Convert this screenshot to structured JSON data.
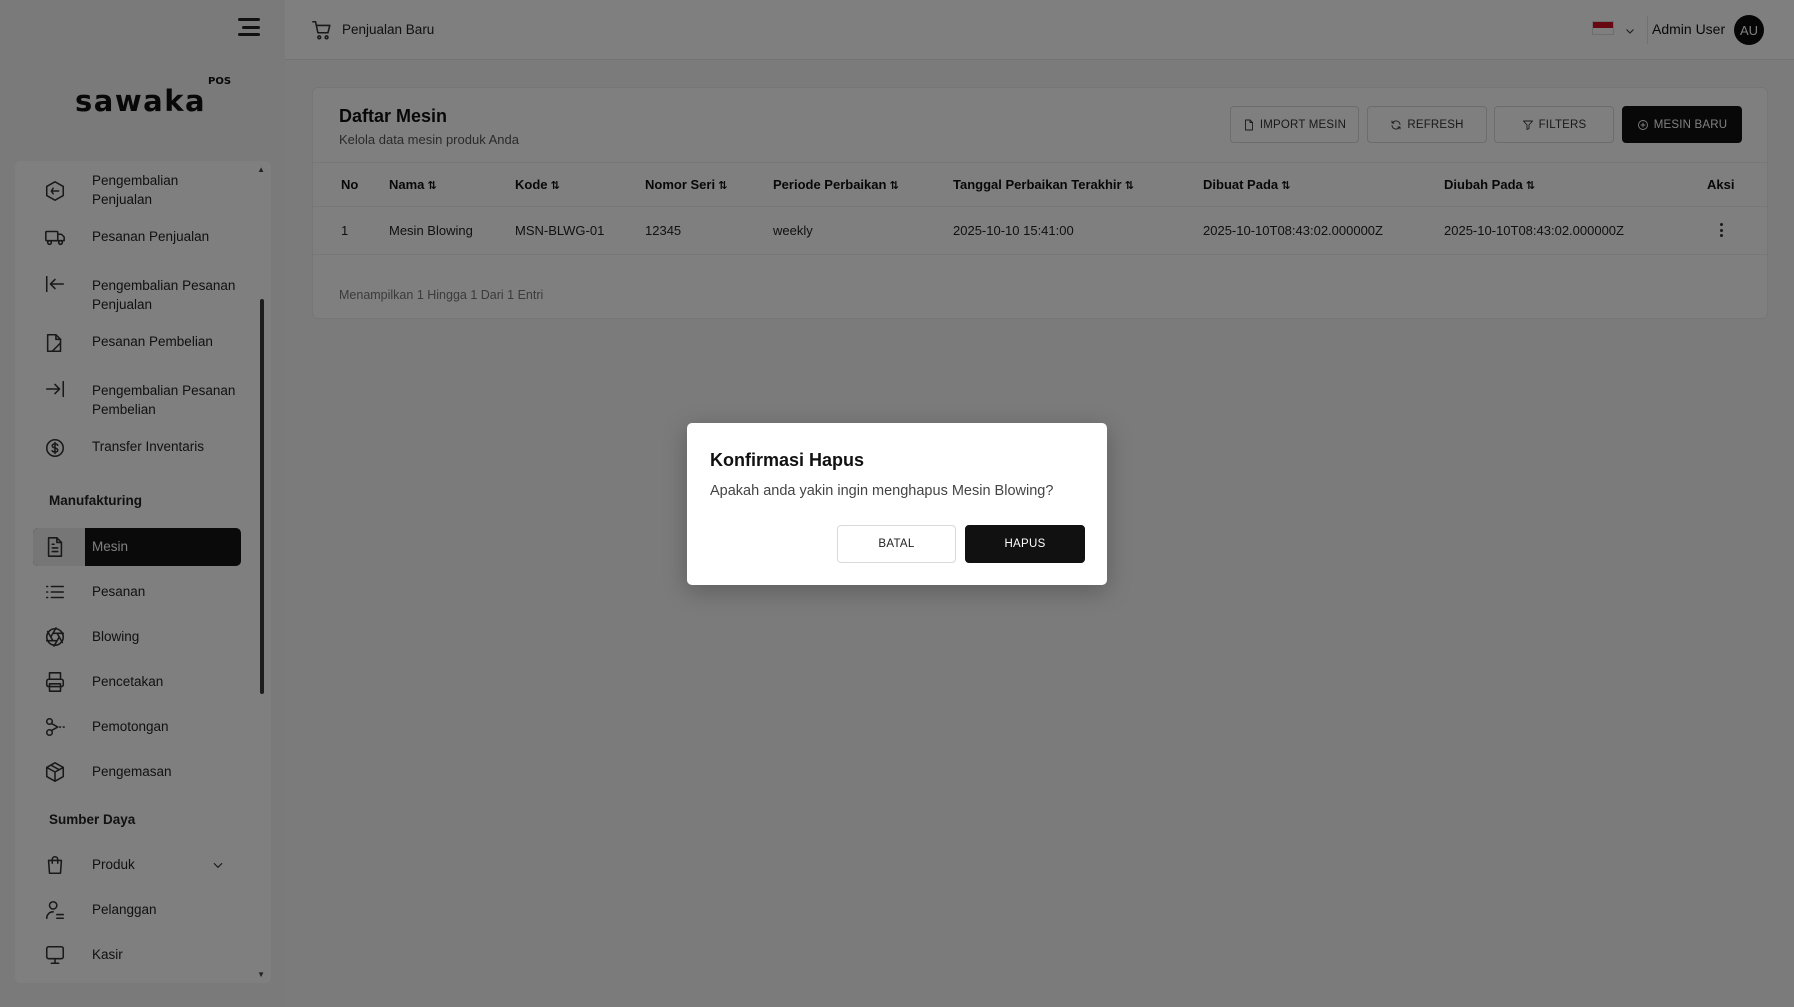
{
  "app": {
    "logo": "sawaka",
    "logo_sup": "POS"
  },
  "header": {
    "title": "Penjualan Baru",
    "user_name": "Admin User",
    "avatar_initials": "AU",
    "flag_colors": [
      "#ce1126",
      "#ffffff"
    ]
  },
  "sidebar": {
    "items": [
      {
        "label": "Pengembalian Penjualan",
        "icon": "return-sale-icon"
      },
      {
        "label": "Pesanan Penjualan",
        "icon": "truck-icon"
      },
      {
        "label": "Pengembalian Pesanan Penjualan",
        "icon": "arrow-left-bar-icon"
      },
      {
        "label": "Pesanan Pembelian",
        "icon": "purchase-order-icon"
      },
      {
        "label": "Pengembalian Pesanan Pembelian",
        "icon": "arrow-right-bar-icon"
      },
      {
        "label": "Transfer Inventaris",
        "icon": "dollar-circle-icon"
      }
    ],
    "section_manufacturing": "Manufakturing",
    "manufacturing_items": [
      {
        "label": "Mesin",
        "icon": "file-text-icon",
        "active": true
      },
      {
        "label": "Pesanan",
        "icon": "list-icon"
      },
      {
        "label": "Blowing",
        "icon": "aperture-icon"
      },
      {
        "label": "Pencetakan",
        "icon": "printer-icon"
      },
      {
        "label": "Pemotongan",
        "icon": "scissors-icon"
      },
      {
        "label": "Pengemasan",
        "icon": "package-icon"
      }
    ],
    "section_resources": "Sumber Daya",
    "resource_items": [
      {
        "label": "Produk",
        "icon": "shopping-bag-icon",
        "expandable": true
      },
      {
        "label": "Pelanggan",
        "icon": "user-icon"
      },
      {
        "label": "Kasir",
        "icon": "monitor-icon"
      }
    ]
  },
  "page": {
    "title": "Daftar Mesin",
    "subtitle": "Kelola data mesin produk Anda",
    "buttons": {
      "import": "IMPORT MESIN",
      "refresh": "REFRESH",
      "filters": "FILTERS",
      "new": "MESIN BARU"
    }
  },
  "table": {
    "columns": [
      "No",
      "Nama",
      "Kode",
      "Nomor Seri",
      "Periode Perbaikan",
      "Tanggal Perbaikan Terakhir",
      "Dibuat Pada",
      "Diubah Pada",
      "Aksi"
    ],
    "sort_glyph": "⇅",
    "rows": [
      [
        "1",
        "Mesin Blowing",
        "MSN-BLWG-01",
        "12345",
        "weekly",
        "2025-10-10 15:41:00",
        "2025-10-10T08:43:02.000000Z",
        "2025-10-10T08:43:02.000000Z"
      ]
    ],
    "footer": "Menampilkan 1 Hingga 1 Dari 1 Entri"
  },
  "dialog": {
    "title": "Konfirmasi Hapus",
    "message": "Apakah anda yakin ingin menghapus Mesin Blowing?",
    "cancel": "BATAL",
    "confirm": "HAPUS"
  },
  "colors": {
    "primary": "#111111",
    "overlay": "rgba(0,0,0,0.5)"
  }
}
